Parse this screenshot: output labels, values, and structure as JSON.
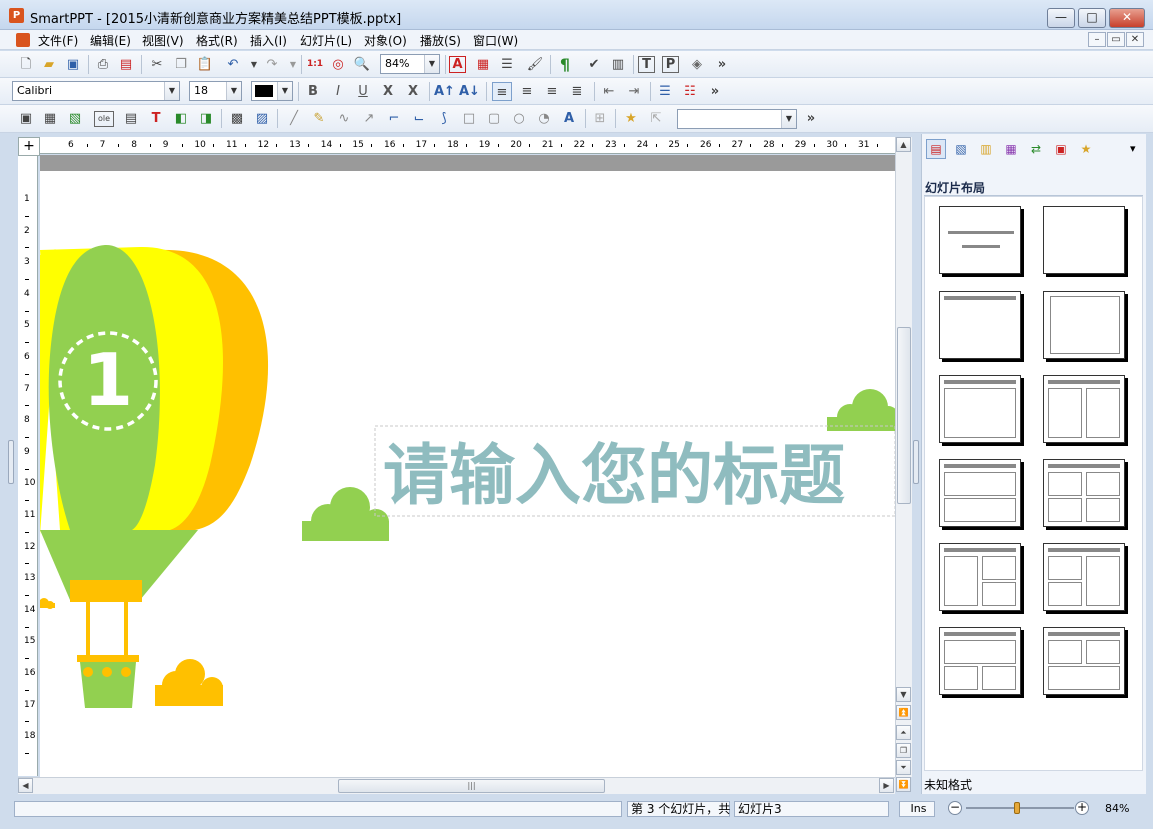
{
  "window": {
    "app_icon": "P",
    "title": "SmartPPT - [2015小清新创意商业方案精美总结PPT模板.pptx]",
    "min_label": "—",
    "max_label": "□",
    "close_label": "✕"
  },
  "menu": {
    "items": [
      "文件(F)",
      "编辑(E)",
      "视图(V)",
      "格式(R)",
      "插入(I)",
      "幻灯片(L)",
      "对象(O)",
      "播放(S)",
      "窗口(W)"
    ],
    "mdi": [
      "–",
      "▭",
      "✕"
    ]
  },
  "toolbar1": {
    "zoom_value": "84%",
    "icons": [
      "new-file-icon",
      "open-folder-icon",
      "save-icon",
      "print-icon",
      "pdf-icon",
      "cut-icon",
      "copy-icon",
      "paste-icon",
      "undo-icon",
      "redo-icon",
      "actual-size-icon",
      "find-icon",
      "zoom-icon",
      "font-color-a-icon",
      "insert-table-icon",
      "list-icon",
      "format-brush-icon",
      "pilcrow-icon",
      "spell-icon",
      "chart-icon",
      "page-t-icon",
      "page-p-icon",
      "3d-icon"
    ],
    "overflow": "»"
  },
  "toolbar2": {
    "font_name": "Calibri",
    "font_size": "18",
    "bold": "B",
    "italic": "I",
    "underline": "U",
    "strike": "X",
    "clear": "X",
    "overflow": "»"
  },
  "toolbar3": {
    "shape_combo_value": "",
    "overflow": "»"
  },
  "slide": {
    "balloon_number": "1",
    "title_text": "请输入您的标题",
    "title_color": "#8fbcbf",
    "green": "#92d050",
    "yellow": "#ffff00",
    "orange": "#ffc000"
  },
  "ruler": {
    "h_numbers": [
      "6",
      "7",
      "8",
      "9",
      "10",
      "11",
      "12",
      "13",
      "14",
      "15",
      "16",
      "17",
      "18",
      "19",
      "20",
      "21",
      "22",
      "23",
      "24",
      "25",
      "26",
      "27",
      "28",
      "29",
      "30",
      "31"
    ],
    "v_numbers": [
      "1",
      "2",
      "3",
      "4",
      "5",
      "6",
      "7",
      "8",
      "9",
      "10",
      "11",
      "12",
      "13",
      "14",
      "15",
      "16",
      "17",
      "18"
    ]
  },
  "right_panel": {
    "section_title": "幻灯片布局",
    "footer_text": "未知格式",
    "tab_icons": [
      "layout-tab-icon",
      "design-tab-icon",
      "color-tab-icon",
      "template-tab-icon",
      "transition-tab-icon",
      "animation-tab-icon",
      "star-tab-icon"
    ],
    "dropdown": "▾"
  },
  "status": {
    "slide_position": "第 3 个幻灯片，共",
    "slide_name": "幻灯片3",
    "insert_mode": "Ins",
    "zoom_value": "84%",
    "zoom_level": 0.5,
    "zoom_minus": "−",
    "zoom_plus": "+"
  }
}
